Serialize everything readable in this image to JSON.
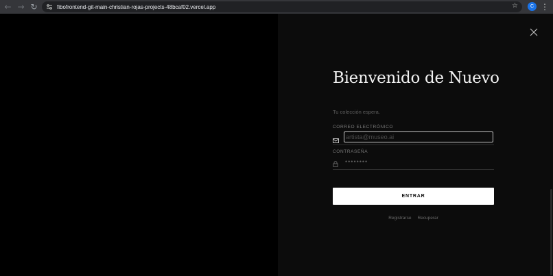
{
  "browser": {
    "url": "fibofrontend-git-main-christian-rojas-projects-48bcaf02.vercel.app",
    "avatar_letter": "C",
    "accent_color": "#1a73e8",
    "icons": [
      "back-arrow-icon",
      "forward-arrow-icon",
      "reload-icon",
      "site-info-icon",
      "bookmark-star-icon",
      "kebab-menu-icon"
    ]
  },
  "login": {
    "title": "Bienvenido de Nuevo",
    "subtitle": "Tu colección espera.",
    "email_label": "CORREO ELECTRÓNICO",
    "email_placeholder": "artista@museo.ai",
    "email_value": "",
    "password_label": "CONTRASEÑA",
    "password_placeholder": "••••••••",
    "password_value": "",
    "submit_label": "ENTRAR",
    "register_link": "Registrarse",
    "recover_link": "Recuperar",
    "icons": [
      "mail-icon",
      "lock-icon",
      "close-icon"
    ]
  },
  "colors": {
    "background": "#0c0c0c",
    "button_bg": "#ffffff",
    "button_text": "#111111"
  }
}
